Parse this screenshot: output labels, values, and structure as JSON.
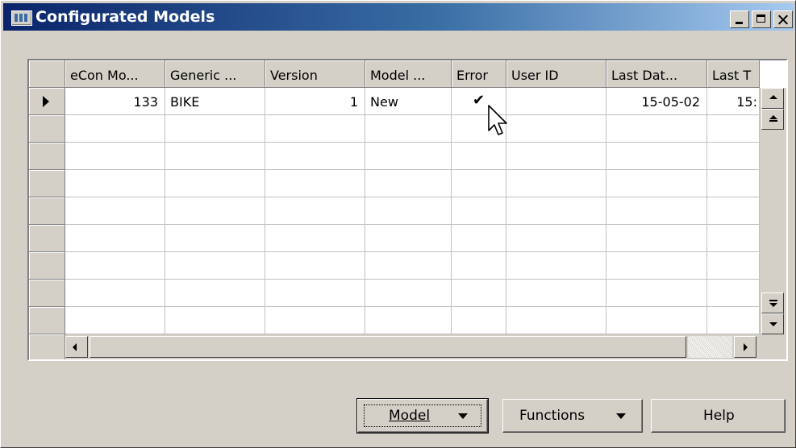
{
  "window": {
    "title": "Configurated Models"
  },
  "grid": {
    "columns": [
      "eCon Mo...",
      "Generic ...",
      "Version",
      "Model ...",
      "Error",
      "User ID",
      "Last Dat...",
      "Last T"
    ],
    "rows": [
      {
        "econ_model": "133",
        "generic": "BIKE",
        "version": "1",
        "model": "New",
        "error": "✔",
        "user_id": "",
        "last_date": "15-05-02",
        "last_time": "15:"
      }
    ]
  },
  "buttons": {
    "model": "Model",
    "functions": "Functions",
    "help": "Help"
  },
  "icons": {
    "window_icon": "form-icon",
    "cursor": "mouse-pointer-icon"
  }
}
